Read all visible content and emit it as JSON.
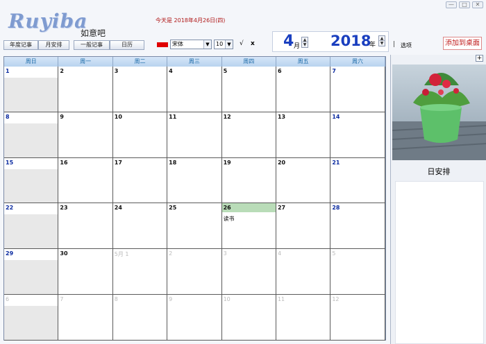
{
  "window": {
    "controls": [
      "—",
      "□",
      "✕"
    ]
  },
  "app": {
    "logo": "Ruyiba",
    "subtitle": "如意吧"
  },
  "today_text": "今天是  2018年4月26日(四)",
  "nav": {
    "annual": "年度记事",
    "monthly": "月安排",
    "general": "一般记事",
    "calendar": "日历"
  },
  "font": {
    "name": "宋体",
    "size": "10",
    "confirm": "√",
    "cancel": "x"
  },
  "month": {
    "value": "4",
    "unit": "月"
  },
  "year": {
    "value": "2018",
    "unit": "年"
  },
  "separator": "|",
  "options_label": "选项",
  "add_to_desktop": "添加到桌面",
  "colors": {
    "accent": "#1a3fbf",
    "swatch": "#e00000",
    "today_highlight": "#b9dcb8"
  },
  "weekdays": [
    "周日",
    "周一",
    "周二",
    "周三",
    "周四",
    "周五",
    "周六"
  ],
  "weeks": [
    [
      {
        "d": "1"
      },
      {
        "d": "2"
      },
      {
        "d": "3"
      },
      {
        "d": "4"
      },
      {
        "d": "5"
      },
      {
        "d": "6"
      },
      {
        "d": "7"
      }
    ],
    [
      {
        "d": "8"
      },
      {
        "d": "9"
      },
      {
        "d": "10"
      },
      {
        "d": "11"
      },
      {
        "d": "12"
      },
      {
        "d": "13"
      },
      {
        "d": "14"
      }
    ],
    [
      {
        "d": "15"
      },
      {
        "d": "16"
      },
      {
        "d": "17"
      },
      {
        "d": "18"
      },
      {
        "d": "19"
      },
      {
        "d": "20"
      },
      {
        "d": "21"
      }
    ],
    [
      {
        "d": "22"
      },
      {
        "d": "23"
      },
      {
        "d": "24"
      },
      {
        "d": "25"
      },
      {
        "d": "26",
        "today": true,
        "note": "读书"
      },
      {
        "d": "27"
      },
      {
        "d": "28"
      }
    ],
    [
      {
        "d": "29"
      },
      {
        "d": "30"
      },
      {
        "d": "5月 1",
        "out": true
      },
      {
        "d": "2",
        "out": true
      },
      {
        "d": "3",
        "out": true
      },
      {
        "d": "4",
        "out": true
      },
      {
        "d": "5",
        "out": true
      }
    ],
    [
      {
        "d": "6",
        "out": true
      },
      {
        "d": "7",
        "out": true
      },
      {
        "d": "8",
        "out": true
      },
      {
        "d": "9",
        "out": true
      },
      {
        "d": "10",
        "out": true
      },
      {
        "d": "11",
        "out": true
      },
      {
        "d": "12",
        "out": true
      }
    ]
  ],
  "sidebar": {
    "add_icon": "+",
    "day_schedule_title": "日安排"
  }
}
